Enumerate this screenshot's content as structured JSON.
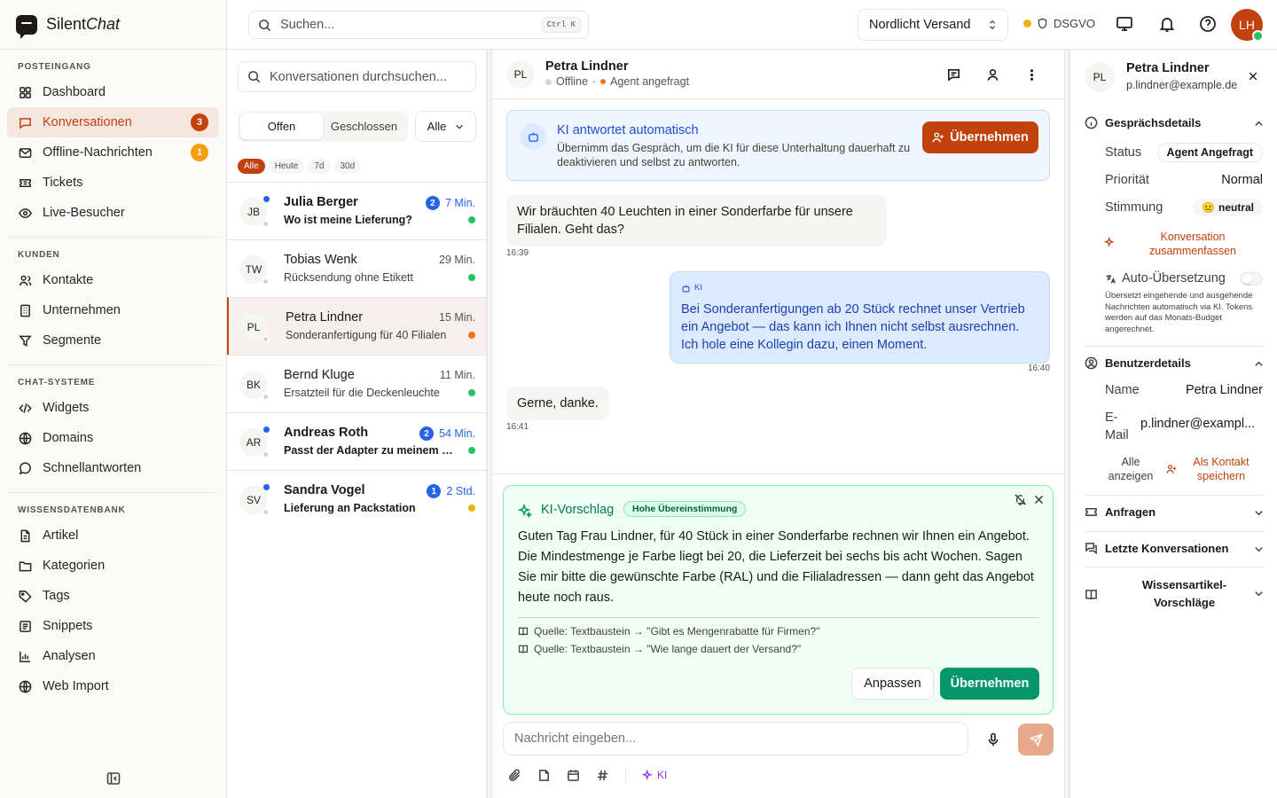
{
  "brand": {
    "name_plain": "Silent",
    "name_italic": "Chat"
  },
  "sidebar": {
    "sections": [
      {
        "title": "POSTEINGANG",
        "items": [
          {
            "label": "Dashboard",
            "icon": "dashboard-icon"
          },
          {
            "label": "Konversationen",
            "icon": "chat-icon",
            "active": true,
            "badge": "3",
            "badge_color": "#c2410c"
          },
          {
            "label": "Offline-Nachrichten",
            "icon": "mail-icon",
            "badge": "1",
            "badge_color": "#f59e0b"
          },
          {
            "label": "Tickets",
            "icon": "ticket-icon"
          },
          {
            "label": "Live-Besucher",
            "icon": "eye-icon"
          }
        ]
      },
      {
        "title": "KUNDEN",
        "items": [
          {
            "label": "Kontakte",
            "icon": "users-icon"
          },
          {
            "label": "Unternehmen",
            "icon": "building-icon"
          },
          {
            "label": "Segmente",
            "icon": "filter-icon"
          }
        ]
      },
      {
        "title": "CHAT-SYSTEME",
        "items": [
          {
            "label": "Widgets",
            "icon": "code-icon"
          },
          {
            "label": "Domains",
            "icon": "globe-icon"
          },
          {
            "label": "Schnellantworten",
            "icon": "message-circle-icon"
          }
        ]
      },
      {
        "title": "WISSENSDATENBANK",
        "items": [
          {
            "label": "Artikel",
            "icon": "file-icon"
          },
          {
            "label": "Kategorien",
            "icon": "folder-icon"
          },
          {
            "label": "Tags",
            "icon": "tag-icon"
          },
          {
            "label": "Snippets",
            "icon": "snippet-icon"
          },
          {
            "label": "Analysen",
            "icon": "bar-chart-icon"
          },
          {
            "label": "Web Import",
            "icon": "globe-icon"
          }
        ]
      }
    ]
  },
  "topbar": {
    "search_placeholder": "Suchen...",
    "shortcut": "Ctrl K",
    "workspace": "Nordlicht Versand",
    "compliance": "DSGVO",
    "user_initials": "LH"
  },
  "conversations": {
    "search_placeholder": "Konversationen durchsuchen...",
    "tabs": [
      "Offen",
      "Geschlossen"
    ],
    "filter": "Alle",
    "chips": [
      "Alle",
      "Heute",
      "7d",
      "30d"
    ],
    "items": [
      {
        "initials": "JB",
        "name": "Julia Berger",
        "preview": "Wo ist meine Lieferung?",
        "time": "7 Min.",
        "count": "2",
        "unread": true,
        "priority_color": "#22c55e"
      },
      {
        "initials": "TW",
        "name": "Tobias Wenk",
        "preview": "Rücksendung ohne Etikett",
        "time": "29 Min.",
        "count": "",
        "unread": false,
        "priority_color": "#22c55e"
      },
      {
        "initials": "PL",
        "name": "Petra Lindner",
        "preview": "Sonderanfertigung für 40 Filialen",
        "time": "15 Min.",
        "count": "",
        "unread": false,
        "priority_color": "#f97316",
        "selected": true
      },
      {
        "initials": "BK",
        "name": "Bernd Kluge",
        "preview": "Ersatzteil für die Deckenleuchte",
        "time": "11 Min.",
        "count": "",
        "unread": false,
        "priority_color": "#22c55e"
      },
      {
        "initials": "AR",
        "name": "Andreas Roth",
        "preview": "Passt der Adapter zu meinem Modell?",
        "time": "54 Min.",
        "count": "2",
        "unread": true,
        "priority_color": "#22c55e"
      },
      {
        "initials": "SV",
        "name": "Sandra Vogel",
        "preview": "Lieferung an Packstation",
        "time": "2 Std.",
        "count": "1",
        "unread": true,
        "priority_color": "#eab308"
      }
    ]
  },
  "chat": {
    "initials": "PL",
    "name": "Petra Lindner",
    "status": "Offline",
    "state": "Agent angefragt",
    "ai_banner": {
      "title": "KI antwortet automatisch",
      "text": "Übernimm das Gespräch, um die KI für diese Unterhaltung dauerhaft zu deaktivieren und selbst zu antworten.",
      "button": "Übernehmen"
    },
    "messages": [
      {
        "from": "customer",
        "text": "Wir bräuchten 40 Leuchten in einer Sonderfarbe für unsere Filialen. Geht das?",
        "time": "16:39"
      },
      {
        "from": "ai",
        "label": "KI",
        "text": "Bei Sonderanfertigungen ab 20 Stück rechnet unser Vertrieb ein Angebot — das kann ich Ihnen nicht selbst ausrechnen. Ich hole eine Kollegin dazu, einen Moment.",
        "time": "16:40"
      },
      {
        "from": "customer",
        "text": "Gerne, danke.",
        "time": "16:41"
      }
    ],
    "suggestion": {
      "title": "KI-Vorschlag",
      "match": "Hohe Übereinstimmung",
      "text": "Guten Tag Frau Lindner, für 40 Stück in einer Sonderfarbe rechnen wir Ihnen ein Angebot. Die Mindestmenge je Farbe liegt bei 20, die Lieferzeit bei sechs bis acht Wochen. Sagen Sie mir bitte die gewünschte Farbe (RAL) und die Filialadressen — dann geht das Angebot heute noch raus.",
      "sources": [
        "Quelle: Textbaustein → \"Gibt es Mengenrabatte für Firmen?\"",
        "Quelle: Textbaustein → \"Wie lange dauert der Versand?\""
      ],
      "adjust": "Anpassen",
      "accept": "Übernehmen"
    },
    "composer_placeholder": "Nachricht eingeben...",
    "ai_tool": "KI"
  },
  "details": {
    "initials": "PL",
    "name": "Petra Lindner",
    "email": "p.lindner@example.de",
    "conv_title": "Gesprächsdetails",
    "status_label": "Status",
    "status": "Agent Angefragt",
    "priority_label": "Priorität",
    "priority": "Normal",
    "mood_label": "Stimmung",
    "mood": "neutral",
    "mood_emoji": "😐",
    "summarize": "Konversation zusammenfassen",
    "translate_label": "Auto-Übersetzung",
    "translate_help": "Übersetzt eingehende und ausgehende Nachrichten automatisch via KI. Tokens werden auf das Monats-Budget angerechnet.",
    "user_title": "Benutzerdetails",
    "name_label": "Name",
    "email_label_1": "E-",
    "email_label_2": "Mail",
    "email_short": "p.lindner@exampl...",
    "show_all_1": "Alle",
    "show_all_2": "anzeigen",
    "save_contact_1": "Als Kontakt",
    "save_contact_2": "speichern",
    "requests": "Anfragen",
    "recent": "Letzte Konversationen",
    "kb_1": "Wissensartikel-",
    "kb_2": "Vorschläge"
  }
}
